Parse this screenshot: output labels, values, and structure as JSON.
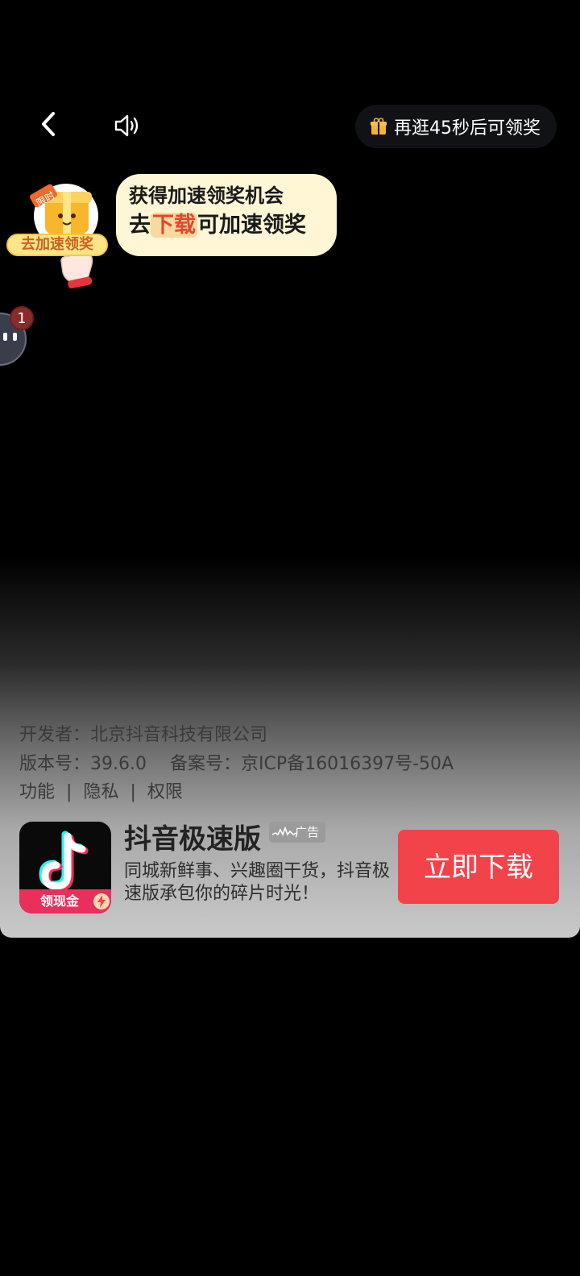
{
  "topbar": {
    "back_icon": "chevron-left-icon",
    "sound_icon": "speaker-icon",
    "reward_text": "再逛45秒后可领奖",
    "gift_icon": "gift-icon",
    "gift_color": "#f5b335"
  },
  "speed_widget": {
    "badge_text": "限时",
    "label": "去加速领奖"
  },
  "bubble": {
    "line1": "获得加速领奖机会",
    "line2_prefix": "去",
    "line2_highlight": "下载",
    "line2_suffix": "可加速领奖"
  },
  "floating": {
    "badge_count": "1"
  },
  "ad": {
    "developer": "开发者：北京抖音科技有限公司",
    "version": "版本号：39.6.0",
    "filing": "备案号：京ICP备16016397号-50A",
    "links": [
      "功能",
      "隐私",
      "权限"
    ],
    "link_separator": "|",
    "app_name": "抖音极速版",
    "ad_tag": "广告",
    "description": "同城新鲜事、兴趣圈干货，抖音极速版承包你的碎片时光！",
    "icon_strip_text": "领现金",
    "download_label": "立即下载",
    "accent": "#f2434a"
  }
}
